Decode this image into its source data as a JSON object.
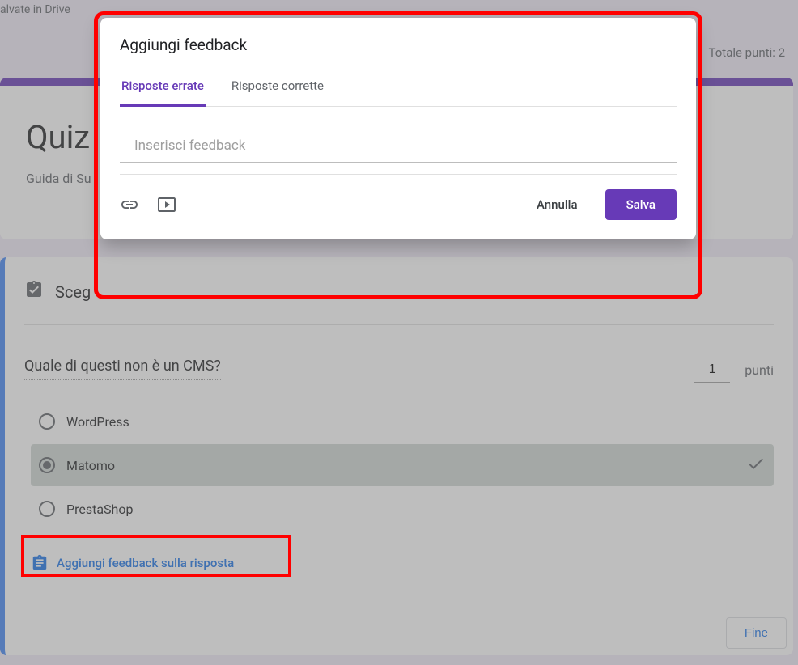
{
  "header": {
    "save_status": "alvate in Drive",
    "total_points": "Totale punti: 2"
  },
  "form": {
    "title": "Quiz",
    "subtitle": "Guida di Su"
  },
  "answer_card": {
    "section_title": "Sceg",
    "question_text": "Quale di questi non è un CMS?",
    "points_value": "1",
    "points_label": "punti",
    "options": [
      {
        "label": "WordPress",
        "selected": false
      },
      {
        "label": "Matomo",
        "selected": true
      },
      {
        "label": "PrestaShop",
        "selected": false
      }
    ],
    "add_feedback_label": "Aggiungi feedback sulla risposta",
    "done_label": "Fine"
  },
  "dialog": {
    "title": "Aggiungi feedback",
    "tabs": [
      {
        "label": "Risposte errate",
        "active": true
      },
      {
        "label": "Risposte corrette",
        "active": false
      }
    ],
    "input_placeholder": "Inserisci feedback",
    "cancel_label": "Annulla",
    "save_label": "Salva"
  }
}
